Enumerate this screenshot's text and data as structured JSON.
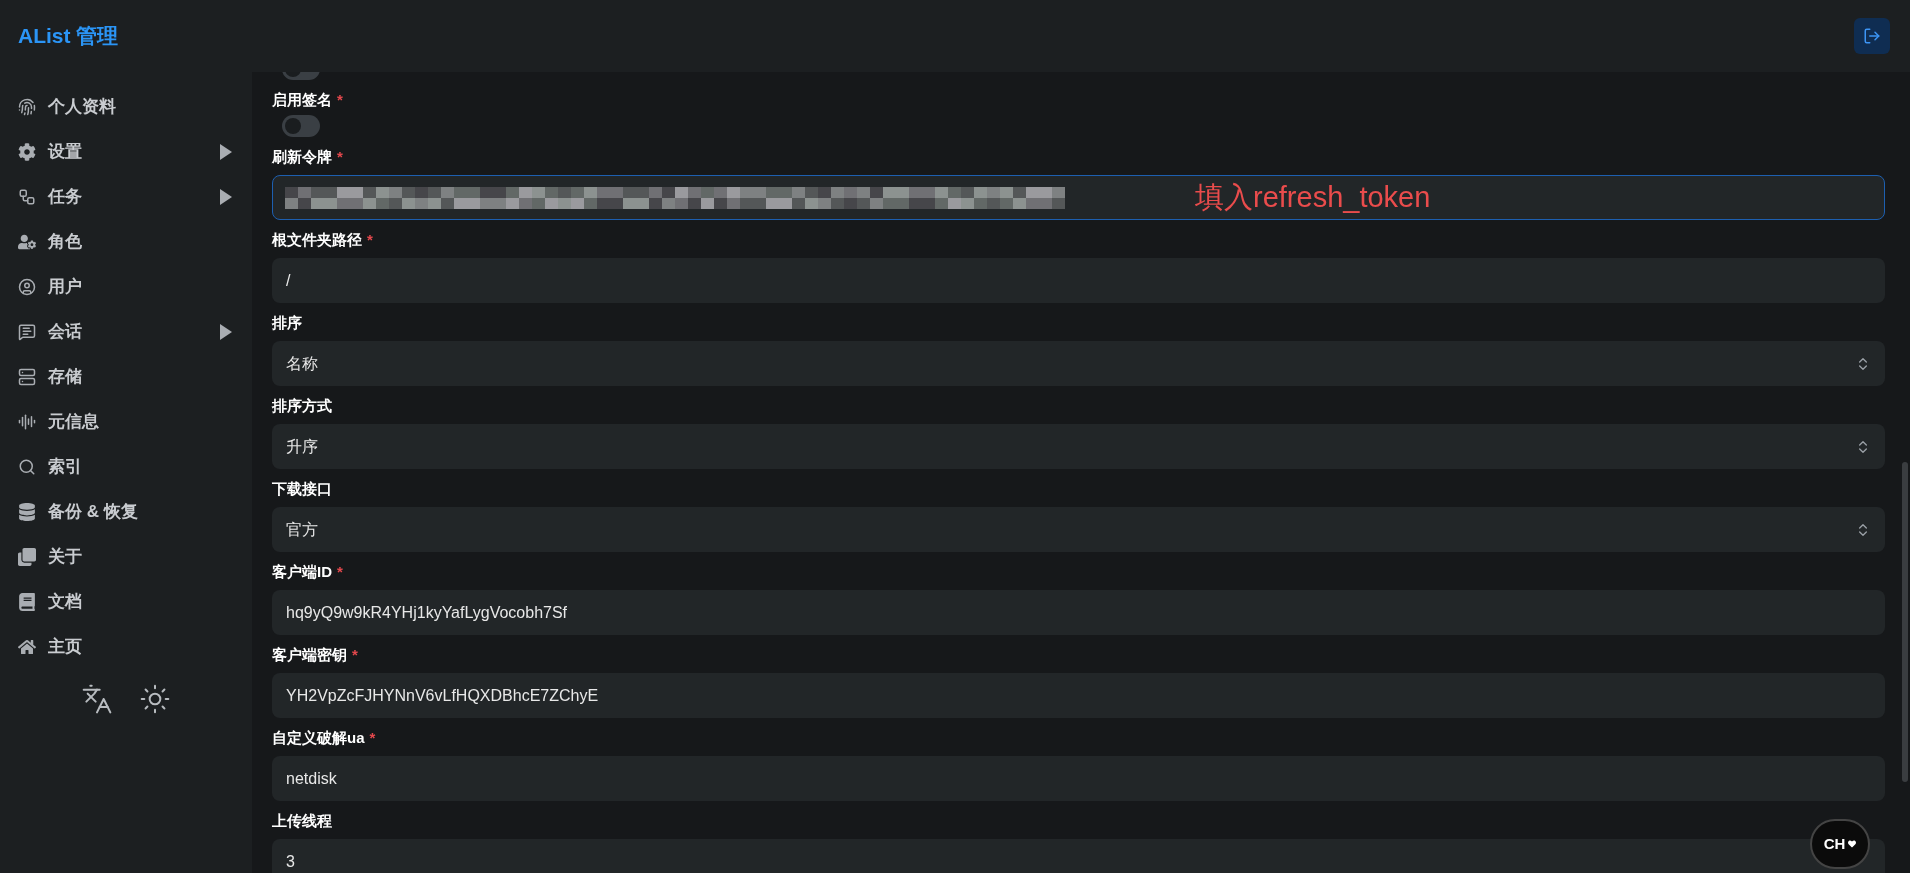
{
  "header": {
    "title": "AList 管理"
  },
  "sidebar": {
    "items": [
      {
        "label": "个人资料",
        "has_submenu": false
      },
      {
        "label": "设置",
        "has_submenu": true
      },
      {
        "label": "任务",
        "has_submenu": true
      },
      {
        "label": "角色",
        "has_submenu": false
      },
      {
        "label": "用户",
        "has_submenu": false
      },
      {
        "label": "会话",
        "has_submenu": true
      },
      {
        "label": "存储",
        "has_submenu": false
      },
      {
        "label": "元信息",
        "has_submenu": false
      },
      {
        "label": "索引",
        "has_submenu": false
      },
      {
        "label": "备份 & 恢复",
        "has_submenu": false
      },
      {
        "label": "关于",
        "has_submenu": false
      },
      {
        "label": "文档",
        "has_submenu": false
      },
      {
        "label": "主页",
        "has_submenu": false
      }
    ]
  },
  "form": {
    "fields": [
      {
        "kind": "toggle",
        "on": false
      },
      {
        "kind": "toggle",
        "label": "启用签名",
        "mark": "*",
        "on": false
      },
      {
        "kind": "redacted",
        "label": "刷新令牌",
        "mark": "*",
        "focused": true,
        "annotation": "填入refresh_token"
      },
      {
        "kind": "text",
        "label": "根文件夹路径",
        "mark": "*",
        "value": "/"
      },
      {
        "kind": "select",
        "label": "排序",
        "value": "名称"
      },
      {
        "kind": "select",
        "label": "排序方式",
        "value": "升序"
      },
      {
        "kind": "select",
        "label": "下载接口",
        "value": "官方"
      },
      {
        "kind": "text",
        "label": "客户端ID",
        "mark": "*",
        "value": "hq9yQ9w9kR4YHj1kyYafLygVocobh7Sf"
      },
      {
        "kind": "text",
        "label": "客户端密钥",
        "mark": "*",
        "value": "YH2VpZcFJHYNnV6vLfHQXDBhcE7ZChyE"
      },
      {
        "kind": "text",
        "label": "自定义破解ua",
        "mark": "*",
        "value": "netdisk"
      },
      {
        "kind": "text",
        "label": "上传线程",
        "value": "3"
      }
    ]
  },
  "floating_badge": {
    "text": "CH"
  }
}
